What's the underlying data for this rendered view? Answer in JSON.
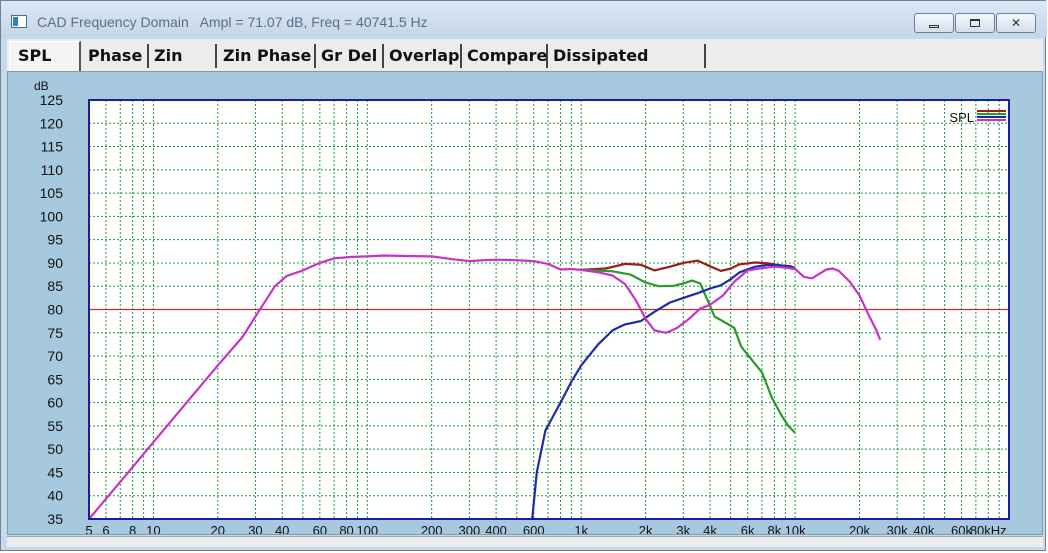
{
  "window": {
    "title": "CAD Frequency Domain   Ampl = 71.07 dB, Freq = 40741.5 Hz",
    "controls": {
      "minimize": "minimize",
      "maximize": "maximize",
      "close": "close"
    }
  },
  "tabs": [
    {
      "label": "SPL",
      "active": true
    },
    {
      "label": "Phase"
    },
    {
      "label": "Zin"
    },
    {
      "label": "Zin Phase"
    },
    {
      "label": "Gr Del"
    },
    {
      "label": "Overlap"
    },
    {
      "label": "Compare"
    },
    {
      "label": "Dissipated Power"
    }
  ],
  "chart_data": {
    "type": "line",
    "title": "",
    "ylabel": "dB",
    "xlabel": "",
    "x_scale": "log",
    "xlim": [
      5,
      100000
    ],
    "ylim": [
      35,
      125
    ],
    "y_ticks": [
      125,
      120,
      115,
      110,
      105,
      100,
      95,
      90,
      85,
      80,
      75,
      70,
      65,
      60,
      55,
      50,
      45,
      40,
      35
    ],
    "x_ticks": [
      {
        "v": 5,
        "label": "5"
      },
      {
        "v": 6,
        "label": "6"
      },
      {
        "v": 8,
        "label": "8"
      },
      {
        "v": 10,
        "label": "10"
      },
      {
        "v": 20,
        "label": "20"
      },
      {
        "v": 30,
        "label": "30"
      },
      {
        "v": 40,
        "label": "40"
      },
      {
        "v": 60,
        "label": "60"
      },
      {
        "v": 80,
        "label": "80"
      },
      {
        "v": 100,
        "label": "100"
      },
      {
        "v": 200,
        "label": "200"
      },
      {
        "v": 300,
        "label": "300"
      },
      {
        "v": 400,
        "label": "400"
      },
      {
        "v": 600,
        "label": "600"
      },
      {
        "v": 1000,
        "label": "1k"
      },
      {
        "v": 2000,
        "label": "2k"
      },
      {
        "v": 3000,
        "label": "3k"
      },
      {
        "v": 4000,
        "label": "4k"
      },
      {
        "v": 6000,
        "label": "6k"
      },
      {
        "v": 8000,
        "label": "8k"
      },
      {
        "v": 10000,
        "label": "10k"
      },
      {
        "v": 20000,
        "label": "20k"
      },
      {
        "v": 30000,
        "label": "30k"
      },
      {
        "v": 40000,
        "label": "40k"
      },
      {
        "v": 60000,
        "label": "60k"
      },
      {
        "v": 80000,
        "label": "80kHz"
      }
    ],
    "reference_line": {
      "y": 80,
      "color": "#c0302c"
    },
    "grid": true,
    "grid_color": "#1a9a3a",
    "axes_color": "#1c1c9c",
    "legend": {
      "label": "SPL",
      "placement": "top-right"
    },
    "series": [
      {
        "color": "#9b1c1c",
        "points": [
          [
            1000,
            88.5
          ],
          [
            1300,
            88.8
          ],
          [
            1600,
            89.8
          ],
          [
            1900,
            89.6
          ],
          [
            2200,
            88.4
          ],
          [
            2600,
            89.2
          ],
          [
            3000,
            90.0
          ],
          [
            3500,
            90.5
          ],
          [
            4000,
            89.3
          ],
          [
            4500,
            88.3
          ],
          [
            5000,
            88.8
          ],
          [
            5500,
            89.7
          ],
          [
            6500,
            90.1
          ],
          [
            7500,
            89.9
          ],
          [
            8500,
            89.5
          ],
          [
            9500,
            89.3
          ],
          [
            10000,
            88.9
          ]
        ]
      },
      {
        "color": "#2a9a2a",
        "points": [
          [
            1000,
            88.5
          ],
          [
            1400,
            88.2
          ],
          [
            1700,
            87.5
          ],
          [
            2000,
            85.8
          ],
          [
            2300,
            85.0
          ],
          [
            2700,
            85.1
          ],
          [
            3000,
            85.6
          ],
          [
            3300,
            86.2
          ],
          [
            3600,
            85.6
          ],
          [
            3900,
            82.0
          ],
          [
            4200,
            78.5
          ],
          [
            4800,
            77.0
          ],
          [
            5200,
            76.0
          ],
          [
            5600,
            72.0
          ],
          [
            6200,
            69.5
          ],
          [
            7000,
            66.5
          ],
          [
            7800,
            61.0
          ],
          [
            8700,
            57.0
          ],
          [
            9300,
            55.0
          ],
          [
            10000,
            53.5
          ]
        ]
      },
      {
        "color": "#1c2ca8",
        "points": [
          [
            590,
            35.0
          ],
          [
            620,
            45.0
          ],
          [
            680,
            54.0
          ],
          [
            800,
            60.0
          ],
          [
            900,
            64.5
          ],
          [
            1000,
            68.0
          ],
          [
            1200,
            72.5
          ],
          [
            1400,
            75.5
          ],
          [
            1600,
            76.8
          ],
          [
            1900,
            77.5
          ],
          [
            2200,
            79.5
          ],
          [
            2600,
            81.5
          ],
          [
            3000,
            82.5
          ],
          [
            3500,
            83.5
          ],
          [
            4000,
            84.5
          ],
          [
            4500,
            85.2
          ],
          [
            5000,
            86.5
          ],
          [
            5500,
            88.0
          ],
          [
            6500,
            89.2
          ],
          [
            7500,
            89.6
          ],
          [
            8500,
            89.5
          ],
          [
            9500,
            89.2
          ],
          [
            10000,
            88.9
          ]
        ]
      },
      {
        "color": "#c633c6",
        "points": [
          [
            5,
            35.0
          ],
          [
            7,
            43.0
          ],
          [
            10,
            51.5
          ],
          [
            14,
            59.5
          ],
          [
            20,
            68.0
          ],
          [
            26,
            74.0
          ],
          [
            32,
            80.5
          ],
          [
            37,
            85.0
          ],
          [
            42,
            87.2
          ],
          [
            50,
            88.4
          ],
          [
            60,
            90.0
          ],
          [
            70,
            91.0
          ],
          [
            85,
            91.3
          ],
          [
            100,
            91.4
          ],
          [
            120,
            91.6
          ],
          [
            150,
            91.5
          ],
          [
            200,
            91.4
          ],
          [
            250,
            90.8
          ],
          [
            300,
            90.4
          ],
          [
            350,
            90.6
          ],
          [
            400,
            90.7
          ],
          [
            500,
            90.6
          ],
          [
            600,
            90.4
          ],
          [
            700,
            89.8
          ],
          [
            800,
            88.6
          ],
          [
            900,
            88.7
          ],
          [
            1000,
            88.5
          ],
          [
            1200,
            88.0
          ],
          [
            1400,
            87.3
          ],
          [
            1600,
            85.5
          ],
          [
            1800,
            82.0
          ],
          [
            2000,
            78.0
          ],
          [
            2200,
            75.5
          ],
          [
            2500,
            75.0
          ],
          [
            2800,
            76.0
          ],
          [
            3200,
            78.0
          ],
          [
            3600,
            80.2
          ],
          [
            4000,
            81.0
          ],
          [
            4600,
            83.0
          ],
          [
            5200,
            86.0
          ],
          [
            6000,
            88.4
          ],
          [
            7000,
            88.9
          ],
          [
            8000,
            89.2
          ],
          [
            9000,
            89.0
          ],
          [
            10000,
            88.7
          ],
          [
            11000,
            87.0
          ],
          [
            12000,
            86.7
          ],
          [
            13000,
            87.7
          ],
          [
            14000,
            88.6
          ],
          [
            15000,
            88.8
          ],
          [
            16000,
            88.3
          ],
          [
            18000,
            86.0
          ],
          [
            20000,
            83.0
          ],
          [
            22000,
            79.0
          ],
          [
            24000,
            75.5
          ],
          [
            25000,
            73.5
          ]
        ]
      }
    ]
  }
}
